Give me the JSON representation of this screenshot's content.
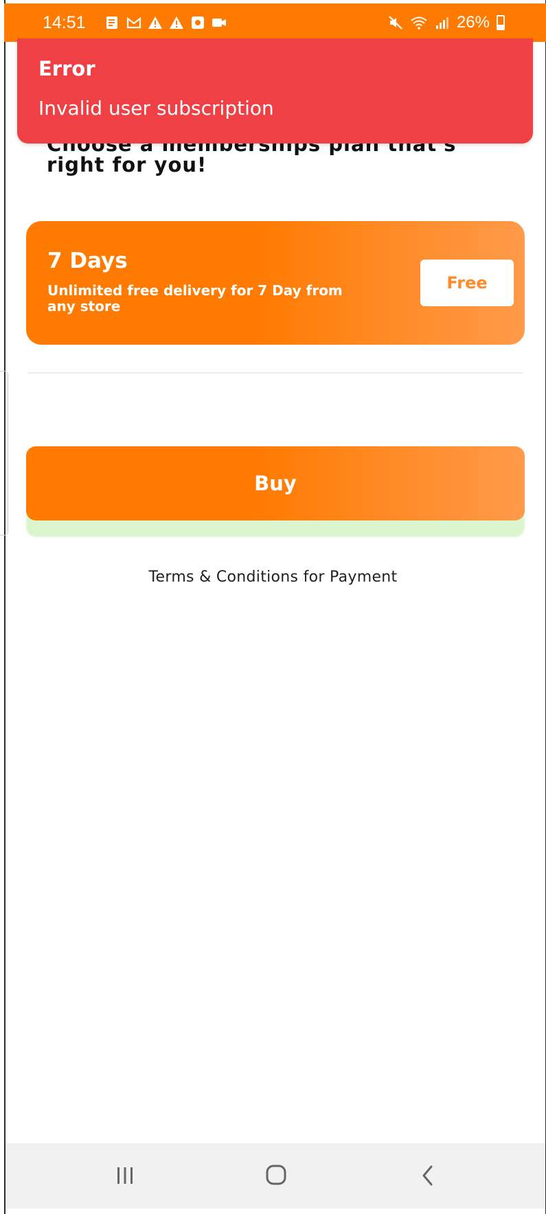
{
  "status_bar": {
    "time": "14:51",
    "battery": "26%",
    "left_icons": [
      "notes-icon",
      "gmail-icon",
      "warning-icon",
      "warning-icon",
      "screen-record-icon",
      "video-icon"
    ],
    "right_icons": [
      "mute-icon",
      "wifi-icon",
      "signal-icon",
      "battery-icon"
    ],
    "color": "#ff7a00"
  },
  "error_toast": {
    "title": "Error",
    "message": "Invalid user subscription",
    "color": "#ef4046"
  },
  "page": {
    "heading": "Choose a memberships plan that's right for you!"
  },
  "plan": {
    "title": "7 Days",
    "description": "Unlimited free delivery for 7 Day from any store",
    "price_label": "Free"
  },
  "buy_button": {
    "label": "Buy"
  },
  "terms_link": "Terms & Conditions for Payment",
  "nav_bar": {
    "buttons": [
      "recent-apps-icon",
      "home-icon",
      "back-icon"
    ]
  },
  "colors": {
    "accent": "#ff7a00",
    "accent_light": "#ff9a4a",
    "error": "#ef4046"
  }
}
